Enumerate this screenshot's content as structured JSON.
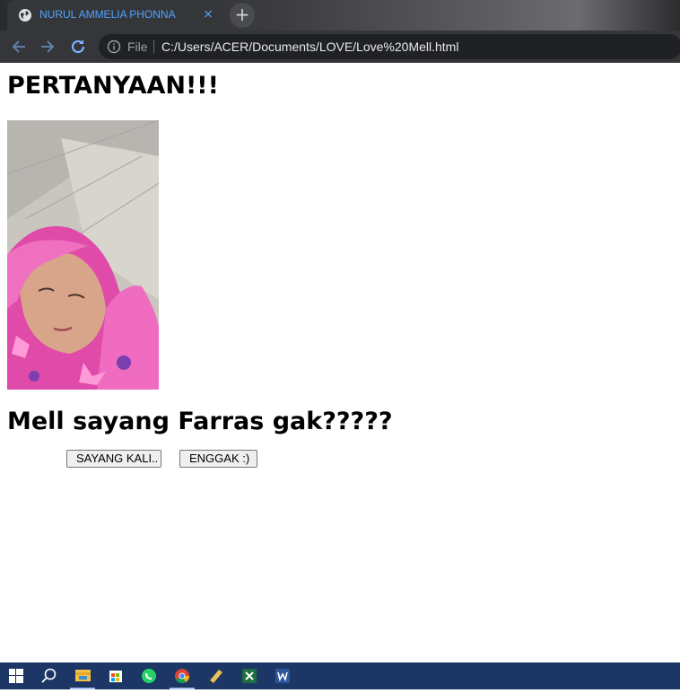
{
  "browser": {
    "tab_title": "NURUL AMMELIA PHONNA",
    "tab_close": "×",
    "new_tab": "+",
    "file_label": "File",
    "url": "C:/Users/ACER/Documents/LOVE/Love%20Mell.html"
  },
  "page": {
    "heading": "PERTANYAAN!!!",
    "question": "Mell sayang Farras gak?????",
    "buttons": {
      "yes_label": "SAYANG KALI..",
      "no_label": "ENGGAK :)"
    }
  },
  "taskbar": {
    "icons": [
      "windows-start-icon",
      "search-icon",
      "file-explorer-icon",
      "store-icon",
      "whatsapp-icon",
      "chrome-icon",
      "app-icon",
      "excel-icon",
      "word-icon"
    ]
  }
}
